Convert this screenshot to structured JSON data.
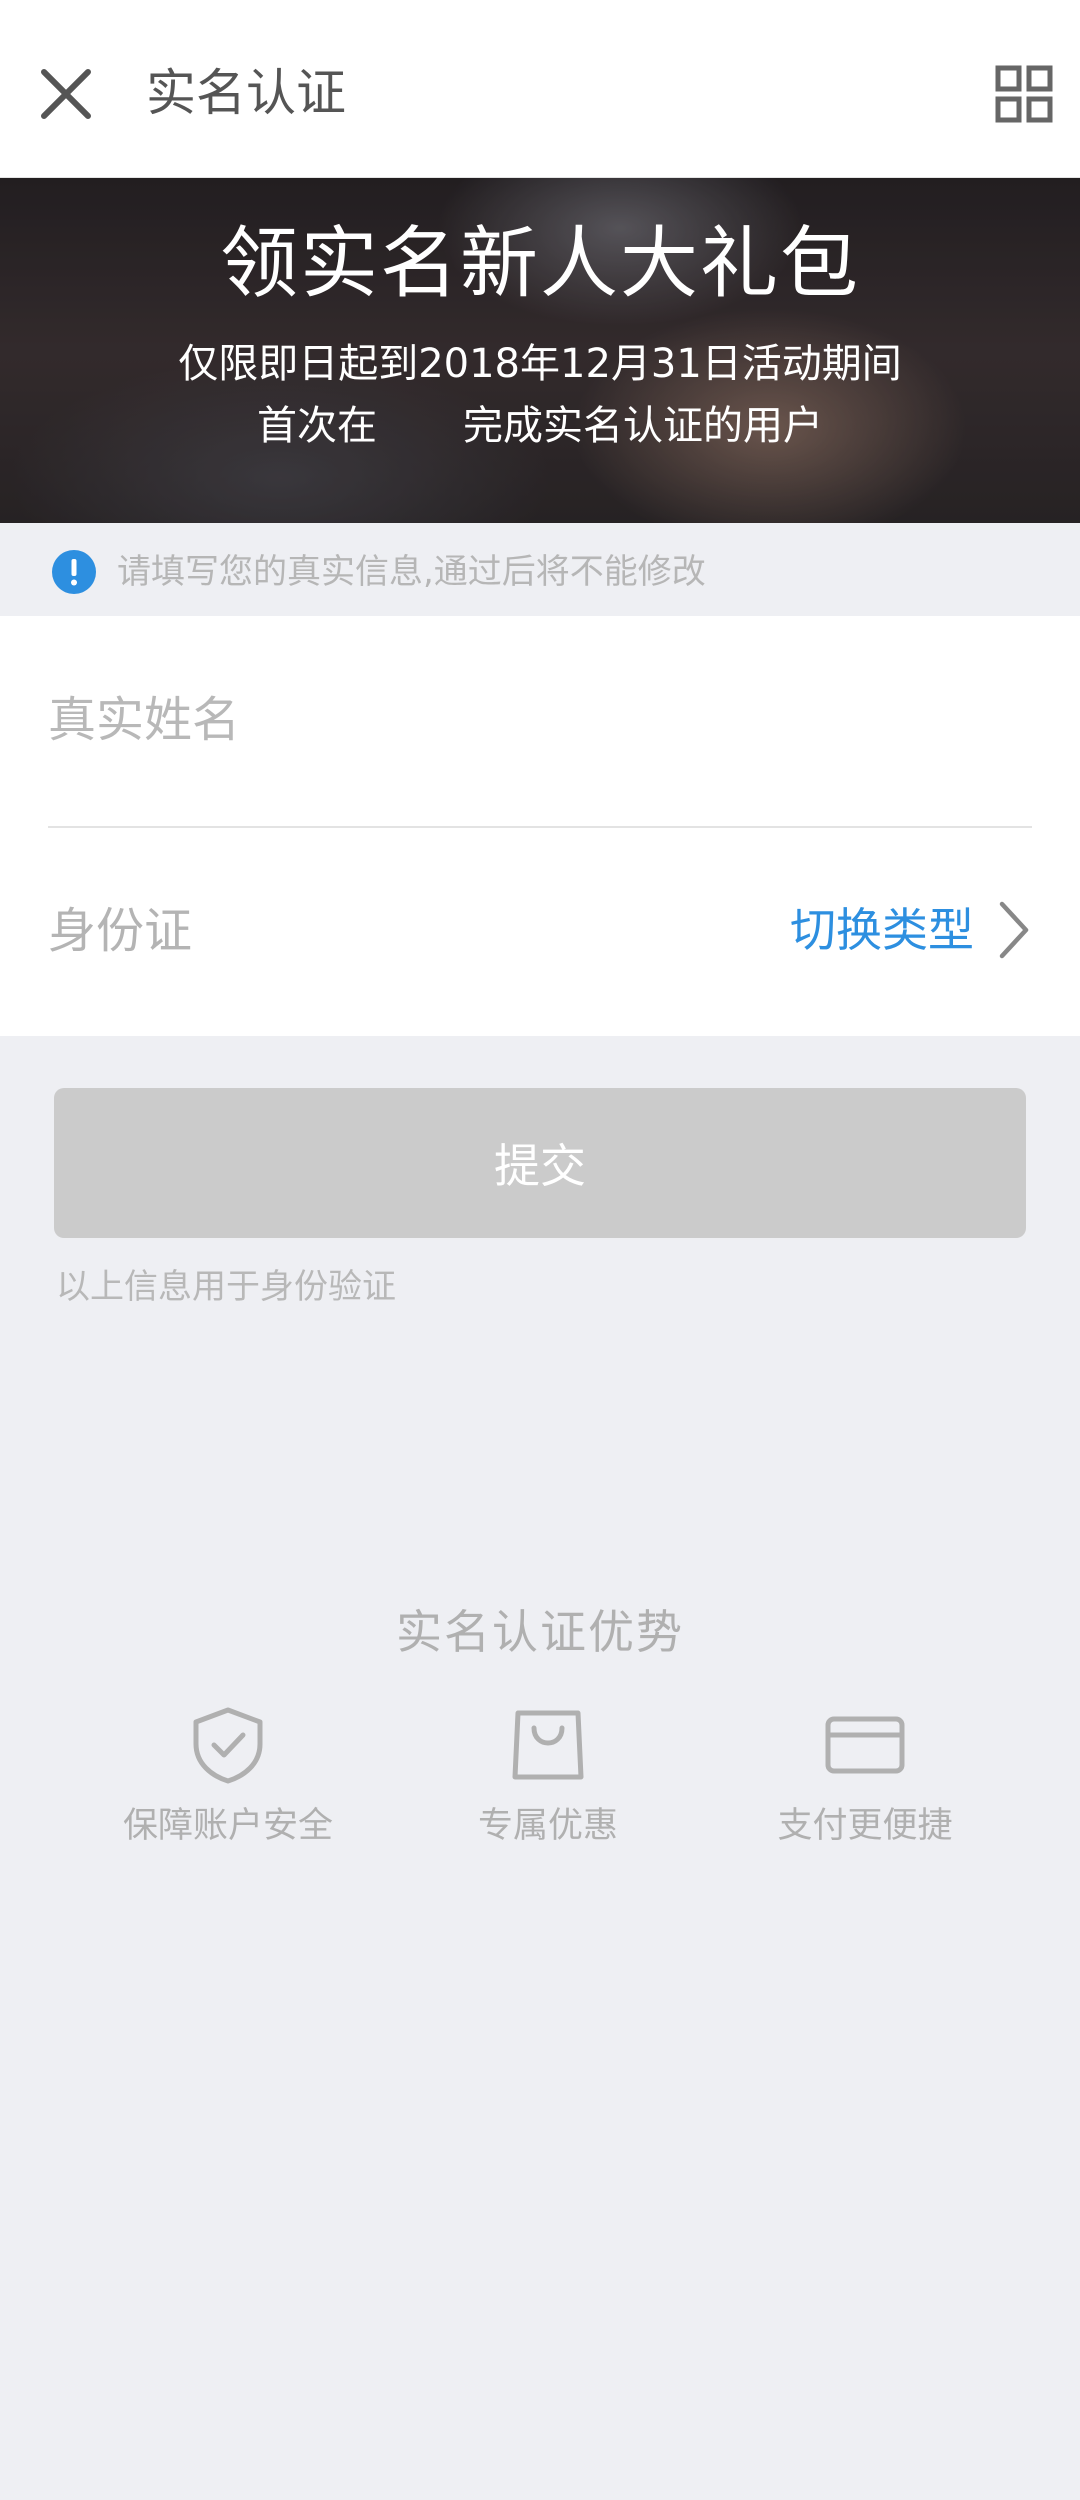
{
  "header": {
    "title": "实名认证",
    "close_icon": "close-icon",
    "menu_icon": "grid-icon"
  },
  "banner": {
    "title": "领实名新人大礼包",
    "line1": "仅限即日起到2018年12月31日活动期间",
    "line2_before": "首次在",
    "line2_after": "完成实名认证的用户"
  },
  "notice": {
    "icon": "exclamation-icon",
    "text": "请填写您的真实信息,通过后将不能修改",
    "icon_color": "#2d8fe0"
  },
  "form": {
    "name_placeholder": "真实姓名",
    "name_value": "",
    "id_label": "身份证",
    "switch_label": "切换类型",
    "switch_icon": "chevron-right-icon",
    "accent_color": "#2d8fe0"
  },
  "submit": {
    "label": "提交",
    "note": "以上信息用于身份验证"
  },
  "advantages": {
    "title": "实名认证优势",
    "items": [
      {
        "icon": "shield-check-icon",
        "label": "保障账户安全"
      },
      {
        "icon": "shopping-bag-icon",
        "label": "专属优惠"
      },
      {
        "icon": "card-icon",
        "label": "支付更便捷"
      }
    ]
  }
}
